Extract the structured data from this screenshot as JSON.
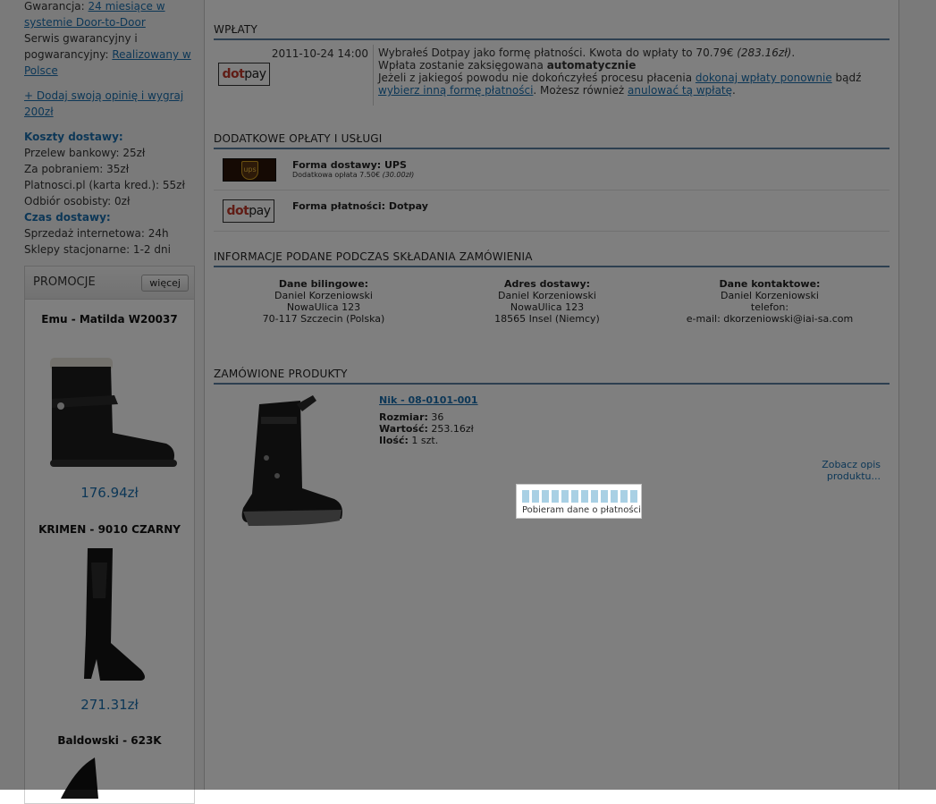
{
  "sidebar": {
    "warranty_label": "Gwarancja:",
    "warranty_link": "24 miesiące w systemie Door-to-Door",
    "service_label": "Serwis gwarancyjny i pogwarancyjny:",
    "service_link": "Realizowany w Polsce",
    "add_opinion_link": "+ Dodaj swoją opinię i wygraj 200zł",
    "delivery_costs_header": "Koszty dostawy:",
    "delivery_costs": [
      "Przelew bankowy: 25zł",
      "Za pobraniem: 35zł",
      "Platnosci.pl (karta kred.): 55zł",
      "Odbiór osobisty: 0zł"
    ],
    "delivery_time_header": "Czas dostawy:",
    "delivery_times": [
      "Sprzedaż internetowa: 24h",
      "Sklepy stacjonarne: 1-2 dni"
    ],
    "promo": {
      "title": "PROMOCJE",
      "more_label": "więcej",
      "items": [
        {
          "name": "Emu - Matilda W20037",
          "price": "176.94zł"
        },
        {
          "name": "KRIMEN - 9010 CZARNY",
          "price": "271.31zł"
        },
        {
          "name": "Baldowski - 623K",
          "price": ""
        }
      ]
    }
  },
  "payments": {
    "title": "WPŁATY",
    "date": "2011-10-24 14:00",
    "logo_text_dot": "dot",
    "logo_text_pay": "pay",
    "line1_a": "Wybrałeś Dotpay jako formę płatności. Kwota do wpłaty to 70.79€ ",
    "line1_b": "(283.16zł)",
    "line1_c": ".",
    "line2_a": "Wpłata zostanie zaksięgowana ",
    "line2_b": "automatycznie",
    "line3_a": "Jeżeli z jakiegoś powodu nie dokończyłeś procesu płacenia ",
    "line3_link1": "dokonaj wpłaty ponownie",
    "line3_b": " bądź ",
    "line3_link2": "wybierz inną formę płatności",
    "line3_c": ". Możesz również ",
    "line3_link3": "anulować tą wpłatę",
    "line3_d": "."
  },
  "extras": {
    "title": "DODATKOWE OPŁATY I USŁUGI",
    "ups_logo": "ups",
    "delivery_label": "Forma dostawy: UPS",
    "delivery_fee_a": "Dodatkowa opłata 7.50€ ",
    "delivery_fee_b": "(30.00zł)",
    "payment_label": "Forma płatności: Dotpay"
  },
  "info": {
    "title": "INFORMACJE PODANE PODCZAS SKŁADANIA ZAMÓWIENIA",
    "billing": {
      "header": "Dane bilingowe:",
      "lines": [
        "Daniel Korzeniowski",
        "NowaUlica 123",
        "70-117 Szczecin (Polska)"
      ]
    },
    "shipping": {
      "header": "Adres dostawy:",
      "lines": [
        "Daniel Korzeniowski",
        "NowaUlica 123",
        "18565 Insel (Niemcy)"
      ]
    },
    "contact": {
      "header": "Dane kontaktowe:",
      "lines": [
        "Daniel Korzeniowski",
        "telefon:",
        "e-mail: dkorzeniowski@iai-sa.com"
      ]
    }
  },
  "products": {
    "title": "ZAMÓWIONE PRODUKTY",
    "name": "Nik - 08-0101-001",
    "size_label": "Rozmiar:",
    "size_value": " 36",
    "value_label": "Wartość:",
    "value_value": " 253.16zł",
    "qty_label": "Ilość:",
    "qty_value": " 1 szt.",
    "details_link": "Zobacz opis produktu..."
  },
  "loader": {
    "text": "Pobieram dane o płatności"
  }
}
